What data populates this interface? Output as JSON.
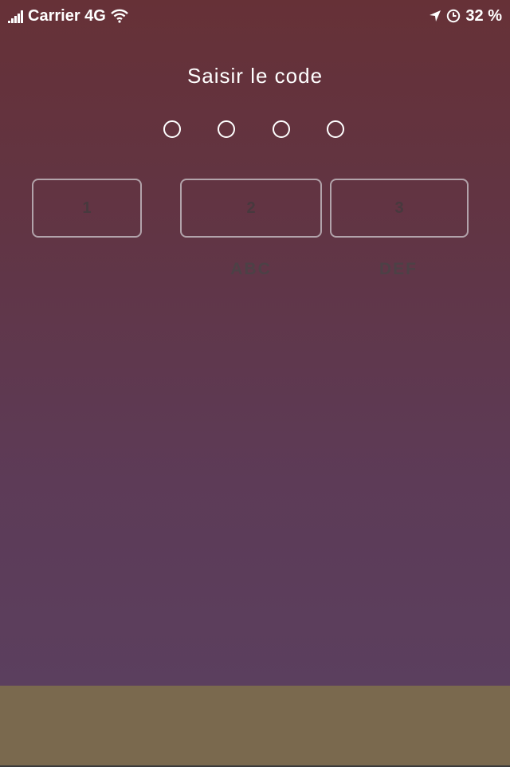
{
  "status_bar": {
    "carrier": "Carrier 4G",
    "battery": "32 %",
    "icons": [
      "signal-icon",
      "wifi-icon",
      "location-arrow-icon",
      "alarm-clock-icon"
    ]
  },
  "title": "Saisir le code",
  "code_entry": {
    "digits_entered": 0,
    "digits_total": 4
  },
  "keypad": [
    {
      "digit": "1",
      "letters": ""
    },
    {
      "digit": "2",
      "letters": "ABC"
    },
    {
      "digit": "3",
      "letters": "DEF"
    }
  ],
  "colors": {
    "background_top": "#663137",
    "background_bottom": "#5b3f5e",
    "bottom_bar": "#7a694e",
    "text": "#ffffff"
  }
}
